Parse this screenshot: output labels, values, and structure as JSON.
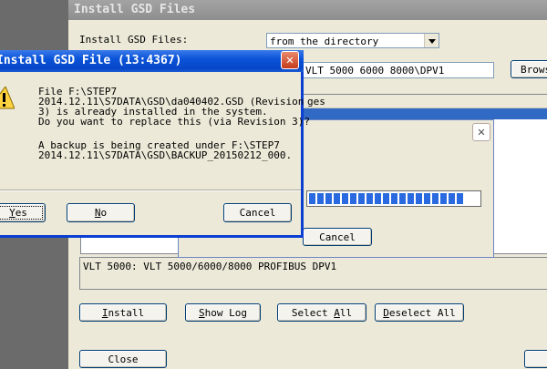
{
  "main_window": {
    "title": "Install GSD Files",
    "install_label": "Install GSD Files:",
    "source_value": "from the directory",
    "path_value": "VLT 5000 6000 8000\\DPV1",
    "browse_label": "Brows",
    "list_header_fragment": "ges",
    "description": "VLT 5000: VLT 5000/6000/8000 PROFIBUS DPV1",
    "buttons": {
      "install": "Install",
      "show_log": "Show Log",
      "select_all": "Select All",
      "deselect_all": "Deselect All",
      "close": "Close"
    }
  },
  "progress_dialog": {
    "cancel_label": "Cancel",
    "progress_blocks": 19
  },
  "confirm_dialog": {
    "title": "Install GSD File (13:4367)",
    "message_lines": [
      "File F:\\STEP7",
      "2014.12.11\\S7DATA\\GSD\\da040402.GSD (Revision",
      "3) is already installed in the system.",
      "Do you want to replace this (via Revision 3)?"
    ],
    "backup_lines": [
      "A backup is being created under F:\\STEP7",
      "2014.12.11\\S7DATA\\GSD\\BACKUP_20150212_000."
    ],
    "buttons": {
      "yes": "Yes",
      "no": "No",
      "cancel": "Cancel"
    }
  }
}
